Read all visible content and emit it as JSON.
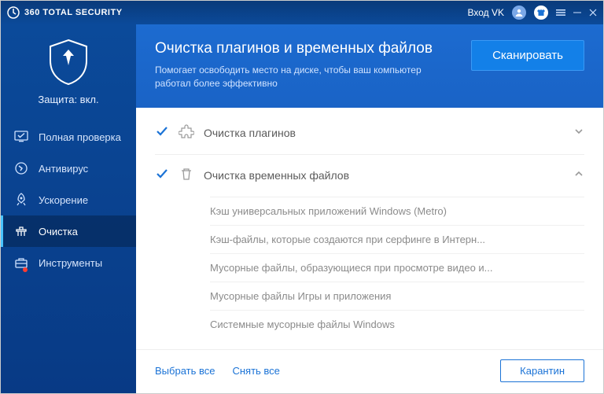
{
  "titlebar": {
    "product_name": "360 TOTAL SECURITY",
    "login_label": "Вход VK"
  },
  "sidebar": {
    "protection_label": "Защита: вкл.",
    "items": [
      {
        "label": "Полная проверка"
      },
      {
        "label": "Антивирус"
      },
      {
        "label": "Ускорение"
      },
      {
        "label": "Очистка"
      },
      {
        "label": "Инструменты"
      }
    ]
  },
  "header": {
    "title": "Очистка плагинов и временных файлов",
    "subtitle": "Помогает освободить место на диске, чтобы ваш компьютер работал более эффективно",
    "scan_button": "Сканировать"
  },
  "sections": [
    {
      "title": "Очистка плагинов"
    },
    {
      "title": "Очистка временных файлов"
    }
  ],
  "temp_files_items": [
    "Кэш универсальных приложений Windows (Metro)",
    "Кэш-файлы, которые создаются при серфинге в Интерн...",
    "Мусорные файлы, образующиеся при просмотре видео и...",
    "Мусорные файлы Игры и приложения",
    "Системные мусорные файлы Windows"
  ],
  "footer": {
    "select_all": "Выбрать все",
    "deselect_all": "Снять все",
    "quarantine": "Карантин"
  }
}
